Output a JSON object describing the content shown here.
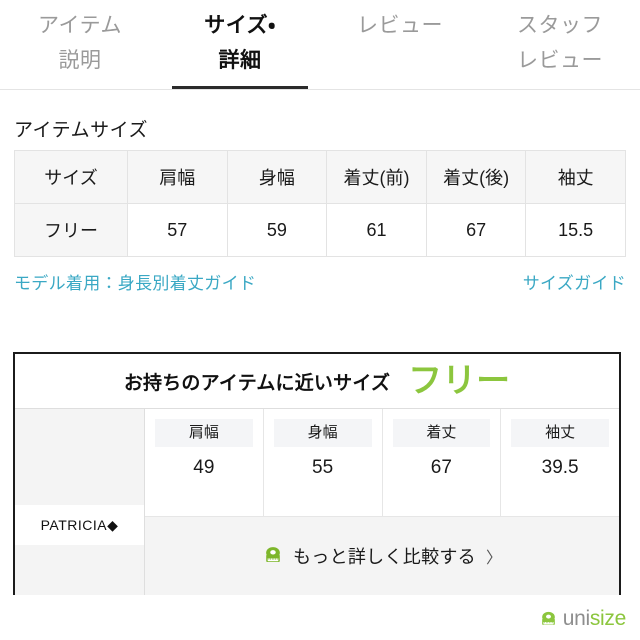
{
  "tabs": [
    {
      "label": "アイテム\n説明",
      "line1": "アイテム",
      "line2": "説明",
      "active": false
    },
    {
      "label": "サイズ・\n詳細",
      "line1": "サイズ・",
      "line2": "詳細",
      "active": true
    },
    {
      "label": "レビュー",
      "line1": "レビュー",
      "line2": "",
      "active": false
    },
    {
      "label": "スタッフ\nレビュー",
      "line1": "スタッフ",
      "line2": "レビュー",
      "active": false
    }
  ],
  "item_size": {
    "heading": "アイテムサイズ",
    "columns": [
      "サイズ",
      "肩幅",
      "身幅",
      "着丈(前)",
      "着丈(後)",
      "袖丈"
    ],
    "rows": [
      [
        "フリー",
        "57",
        "59",
        "61",
        "67",
        "15.5"
      ]
    ]
  },
  "links": {
    "model_guide": "モデル着用：身長別着丈ガイド",
    "size_guide": "サイズガイド"
  },
  "unisize": {
    "panel_title": "お持ちのアイテムに近いサイズ",
    "matched_size": "フリー",
    "brand_label": "PATRICIA◆",
    "measurements": [
      {
        "label": "肩幅",
        "value": "49"
      },
      {
        "label": "身幅",
        "value": "55"
      },
      {
        "label": "着丈",
        "value": "67"
      },
      {
        "label": "袖丈",
        "value": "39.5"
      }
    ],
    "compare_label": "もっと詳しく比較する",
    "compare_arrow": "〉",
    "logo_uni": "uni",
    "logo_size": "size"
  },
  "colors": {
    "link_teal": "#3aa8c4",
    "brand_green": "#8cc63e",
    "active_tab": "#111111",
    "inactive_tab": "#9a9a9a"
  }
}
